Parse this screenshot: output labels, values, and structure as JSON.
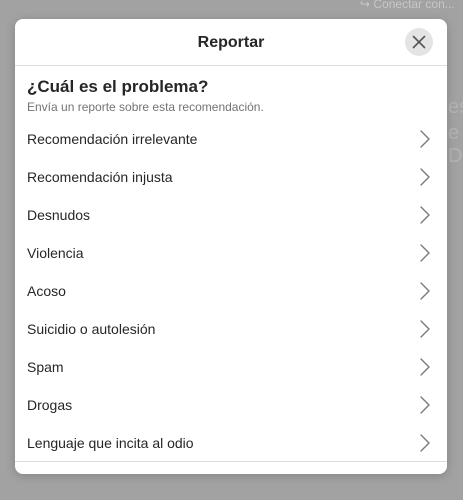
{
  "background": {
    "top_text": "↪ Conectar con...",
    "side_text_1": "es",
    "side_text_2": "e D"
  },
  "modal": {
    "title": "Reportar",
    "close_icon": "close-icon",
    "question": "¿Cuál es el problema?",
    "subtitle": "Envía un reporte sobre esta recomendación.",
    "reasons": [
      {
        "label": "Recomendación irrelevante"
      },
      {
        "label": "Recomendación injusta"
      },
      {
        "label": "Desnudos"
      },
      {
        "label": "Violencia"
      },
      {
        "label": "Acoso"
      },
      {
        "label": "Suicidio o autolesión"
      },
      {
        "label": "Spam"
      },
      {
        "label": "Drogas"
      },
      {
        "label": "Lenguaje que incita al odio"
      }
    ]
  },
  "colors": {
    "overlay": "#a2a2a2",
    "text_primary": "#262626",
    "text_secondary": "#737373",
    "divider": "#dedede",
    "close_bg": "#e4e4e4"
  }
}
